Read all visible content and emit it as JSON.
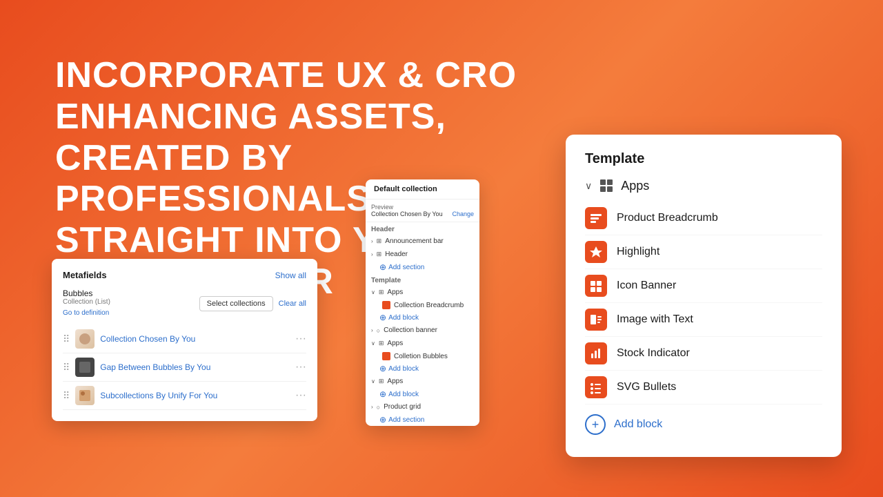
{
  "hero": {
    "line1": "INCORPORATE UX & CRO ENHANCING ASSETS,",
    "line2": "CREATED BY PROFESSIONALS,",
    "line3": "STRAIGHT INTO YOUR THEME EDITOR"
  },
  "metafields": {
    "title": "Metafields",
    "show_all": "Show all",
    "field_label": "Bubbles",
    "field_type": "Collection (List)",
    "field_link": "Go to definition",
    "select_btn": "Select collections",
    "clear_btn": "Clear all",
    "items": [
      {
        "name": "Collection Chosen By You",
        "thumb_type": "img"
      },
      {
        "name": "Gap Between Bubbles By You",
        "thumb_type": "dark"
      },
      {
        "name": "Subcollections By Unify For You",
        "thumb_type": "img2"
      }
    ]
  },
  "theme_editor": {
    "title": "Default collection",
    "preview_label": "Preview",
    "preview_value": "Collection Chosen By You",
    "preview_change": "Change",
    "header_label": "Header",
    "announcement_bar": "Announcement bar",
    "header": "Header",
    "add_section": "Add section",
    "template_label": "Template",
    "apps_label": "Apps",
    "collection_breadcrumb": "Collection Breadcrumb",
    "add_block": "Add block",
    "collection_banner": "Collection banner",
    "apps2_label": "Apps",
    "collection_bubbles": "Colletion Bubbles",
    "apps3_label": "Apps",
    "product_grid": "Product grid",
    "add_section2": "Add section"
  },
  "template_panel": {
    "title": "Template",
    "apps_label": "Apps",
    "items": [
      {
        "name": "Product Breadcrumb"
      },
      {
        "name": "Highlight"
      },
      {
        "name": "Icon Banner"
      },
      {
        "name": "Image with Text"
      },
      {
        "name": "Stock Indicator"
      },
      {
        "name": "SVG Bullets"
      }
    ],
    "add_block": "Add block"
  }
}
